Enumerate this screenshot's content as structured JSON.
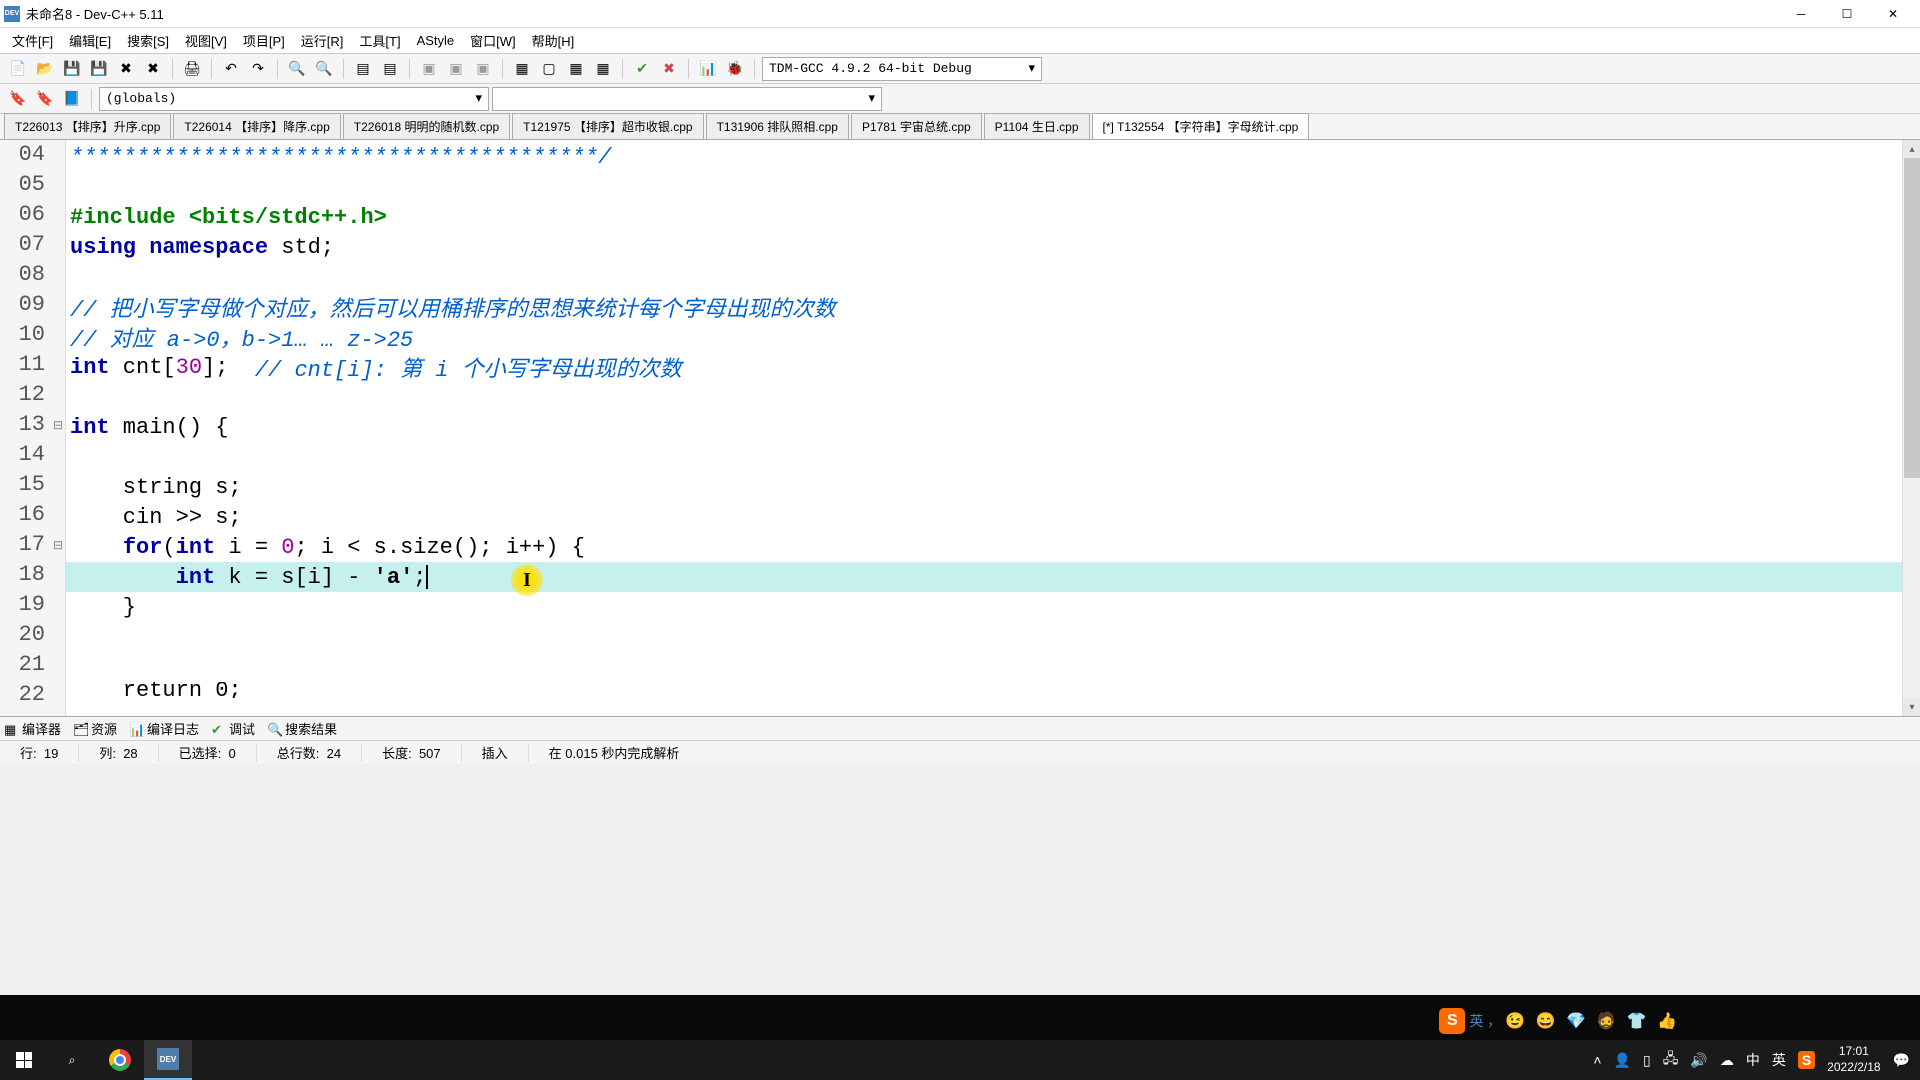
{
  "window": {
    "title": "未命名8 - Dev-C++ 5.11"
  },
  "menu": {
    "file": "文件[F]",
    "edit": "编辑[E]",
    "search": "搜索[S]",
    "view": "视图[V]",
    "project": "项目[P]",
    "run": "运行[R]",
    "tools": "工具[T]",
    "astyle": "AStyle",
    "window": "窗口[W]",
    "help": "帮助[H]"
  },
  "toolbar": {
    "compiler_profile": "TDM-GCC 4.9.2 64-bit Debug",
    "scope_selector": "(globals)"
  },
  "tabs": {
    "t1": "T226013 【排序】升序.cpp",
    "t2": "T226014 【排序】降序.cpp",
    "t3": "T226018 明明的随机数.cpp",
    "t4": "T121975 【排序】超市收银.cpp",
    "t5": "T131906 排队照相.cpp",
    "t6": "P1781 宇宙总统.cpp",
    "t7": "P1104 生日.cpp",
    "t8": "[*] T132554 【字符串】字母统计.cpp"
  },
  "code": {
    "first_line": "04",
    "lines": {
      "l04": "****************************************/",
      "l05": "",
      "l06_include": "#include <bits/stdc++.h>",
      "l07_using": "using",
      "l07_ns": "namespace",
      "l07_std": "std;",
      "l08": "",
      "l09_com": "// 把小写字母做个对应，然后可以用桶排序的思想来统计每个字母出现的次数",
      "l10_com": "// 对应 a->0，b->1… … z->25",
      "l11_int": "int",
      "l11_var": " cnt[",
      "l11_n": "30",
      "l11_rb": "];  ",
      "l11_com": "// cnt[i]: 第 i 个小写字母出现的次数",
      "l12": "",
      "l13_int": "int",
      "l13_main": " main() {",
      "l14": "",
      "l15": "    string s;",
      "l16": "    cin >> s;",
      "l17_for": "for",
      "l17_a": "(",
      "l17_int": "int",
      "l17_b": " i = ",
      "l17_z": "0",
      "l17_c": "; i < s.size(); i++) {",
      "l18_a": "        ",
      "l18_int": "int",
      "l18_b": " k = s[i] - ",
      "l18_ch": "'a'",
      "l18_c": ";",
      "l19": "    }",
      "l20": "",
      "l21": "",
      "l22": "    return 0;"
    },
    "line_numbers": [
      "04",
      "05",
      "06",
      "07",
      "08",
      "09",
      "10",
      "11",
      "12",
      "13",
      "14",
      "15",
      "16",
      "17",
      "18",
      "19",
      "20",
      "21",
      "22"
    ]
  },
  "bottom_tabs": {
    "compiler": "编译器",
    "resources": "资源",
    "compile_log": "编译日志",
    "debug": "调试",
    "search_results": "搜索结果"
  },
  "status": {
    "row_label": "行:",
    "row_val": "19",
    "col_label": "列:",
    "col_val": "28",
    "sel_label": "已选择:",
    "sel_val": "0",
    "total_label": "总行数:",
    "total_val": "24",
    "len_label": "长度:",
    "len_val": "507",
    "mode": "插入",
    "parse_msg": "在 0.015 秒内完成解析"
  },
  "ime": {
    "label": "英 ，"
  },
  "faces": "😉 😄 💎 🧔 👕 👍",
  "clock": {
    "time": "17:01",
    "date": "2022/2/18"
  },
  "tray": {
    "ime_lang": "英",
    "ime_full": "中"
  }
}
